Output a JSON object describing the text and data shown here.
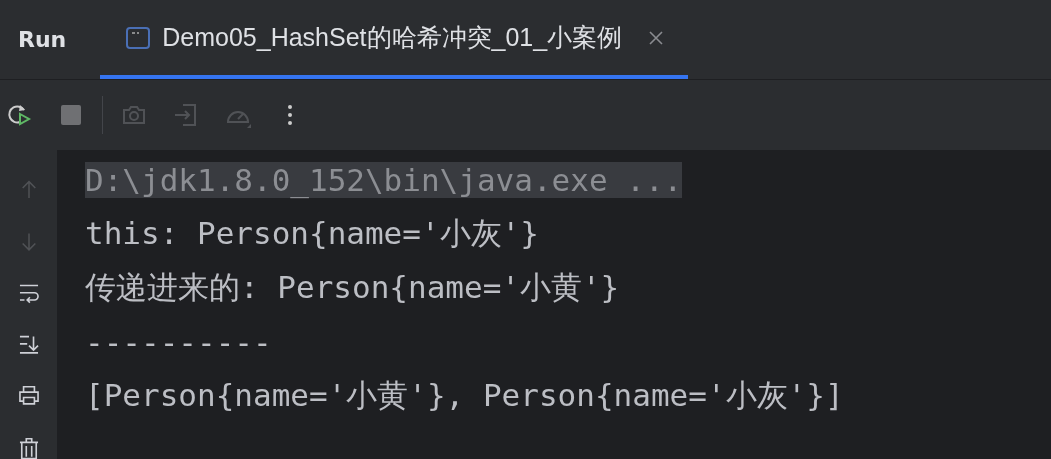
{
  "panel": {
    "title": "Run"
  },
  "tabs": [
    {
      "label": "Demo05_HashSet的哈希冲突_01_小案例",
      "selected": true
    }
  ],
  "toolbar": [
    {
      "kind": "rerun",
      "disabled": false
    },
    {
      "kind": "stop",
      "disabled": false
    },
    {
      "kind": "camera",
      "disabled": true
    },
    {
      "kind": "enter",
      "disabled": true
    },
    {
      "kind": "gauge",
      "disabled": true
    },
    {
      "kind": "more",
      "disabled": false
    }
  ],
  "gutter": [
    {
      "kind": "up",
      "disabled": true
    },
    {
      "kind": "down",
      "disabled": true
    },
    {
      "kind": "wrap",
      "disabled": false
    },
    {
      "kind": "scroll-end",
      "disabled": false
    },
    {
      "kind": "print",
      "disabled": false
    },
    {
      "kind": "trash",
      "disabled": false
    }
  ],
  "console": [
    {
      "kind": "command",
      "text": "D:\\jdk1.8.0_152\\bin\\java.exe ..."
    },
    {
      "kind": "output",
      "text": "this: Person{name='小灰'}"
    },
    {
      "kind": "output",
      "text": "传递进来的: Person{name='小黄'}"
    },
    {
      "kind": "output",
      "text": "----------"
    },
    {
      "kind": "output",
      "text": "[Person{name='小黄'}, Person{name='小灰'}]"
    }
  ]
}
